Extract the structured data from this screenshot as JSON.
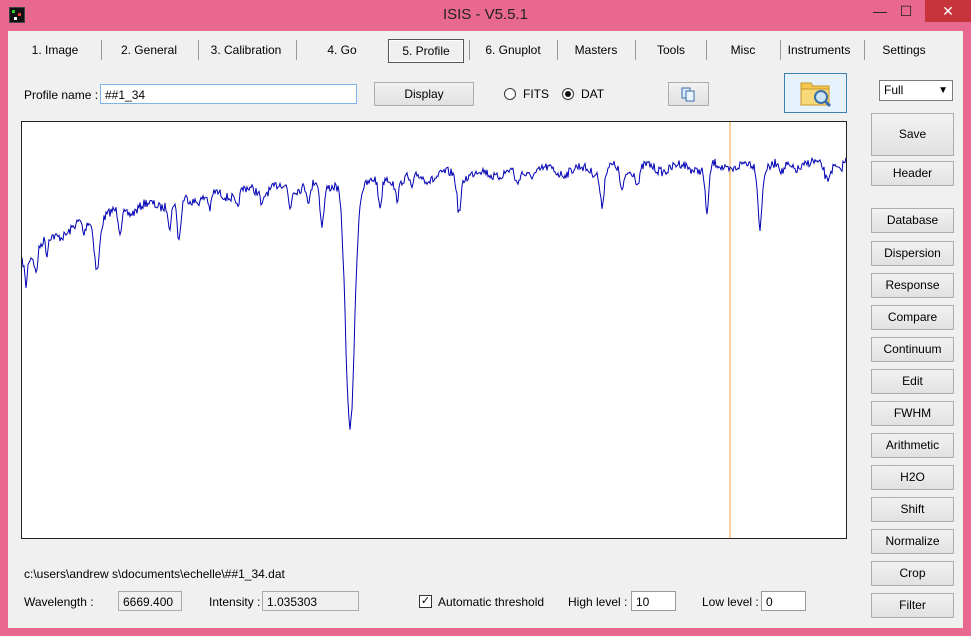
{
  "window": {
    "title": "ISIS - V5.5.1",
    "minimize_glyph": "—",
    "maximize_glyph": "☐",
    "close_glyph": "✕"
  },
  "tabs": [
    {
      "label": "1. Image"
    },
    {
      "label": "2. General"
    },
    {
      "label": "3. Calibration"
    },
    {
      "label": "4. Go"
    },
    {
      "label": "5. Profile"
    },
    {
      "label": "6. Gnuplot"
    },
    {
      "label": "Masters"
    },
    {
      "label": "Tools"
    },
    {
      "label": "Misc"
    },
    {
      "label": "Instruments"
    },
    {
      "label": "Settings"
    }
  ],
  "selected_tab": "5. Profile",
  "profile": {
    "name_label": "Profile name :",
    "name_value": "##1_34",
    "display_button": "Display",
    "format_fits": "FITS",
    "format_dat": "DAT",
    "format_selected": "DAT",
    "copy_icon": "copy-icon",
    "open_icon": "folder-search-icon"
  },
  "side": {
    "zoom_select": "Full",
    "buttons": {
      "save": "Save",
      "header": "Header",
      "database": "Database",
      "dispersion": "Dispersion",
      "response": "Response",
      "compare": "Compare",
      "continuum": "Continuum",
      "edit": "Edit",
      "fwhm": "FWHM",
      "arithmetic": "Arithmetic",
      "h2o": "H2O",
      "shift": "Shift",
      "normalize": "Normalize",
      "crop": "Crop",
      "filter": "Filter"
    }
  },
  "status": {
    "file_path": "c:\\users\\andrew s\\documents\\echelle\\##1_34.dat",
    "wavelength_label": "Wavelength :",
    "wavelength_value": "6669.400",
    "intensity_label": "Intensity :",
    "intensity_value": "1.035303",
    "auto_threshold_label": "Automatic threshold",
    "auto_threshold_checked": true,
    "high_level_label": "High level :",
    "high_level_value": "10",
    "low_level_label": "Low level :",
    "low_level_value": "0"
  },
  "colors": {
    "spectrum": "#0000b4",
    "cursor": "#e8a03c",
    "title_bar": "#e8688f",
    "close": "#c7343c"
  }
}
